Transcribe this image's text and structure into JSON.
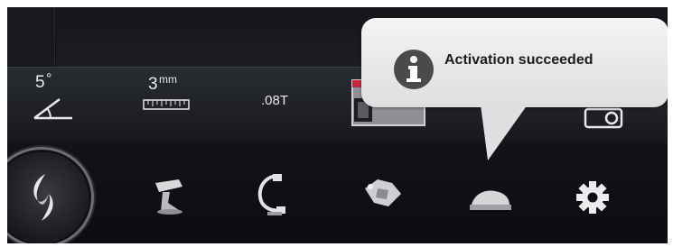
{
  "toolbar": {
    "angle": {
      "value": "5",
      "unit": "°",
      "icon": "angle-icon"
    },
    "thickness": {
      "value": "3",
      "unit": "mm",
      "icon": "ruler-icon"
    },
    "field": {
      "value": ".08T",
      "icon": "field-strength-icon"
    }
  },
  "notification": {
    "message": "Activation succeeded",
    "icon": "info-icon"
  },
  "nav": {
    "items": [
      {
        "id": "home",
        "icon": "logo-home-icon"
      },
      {
        "id": "table",
        "icon": "patient-table-icon"
      },
      {
        "id": "c-arm",
        "icon": "c-arm-icon"
      },
      {
        "id": "collimator",
        "icon": "collimator-icon"
      },
      {
        "id": "coil",
        "icon": "head-coil-icon"
      },
      {
        "id": "settings",
        "icon": "gear-icon"
      }
    ]
  },
  "colors": {
    "accent": "#2fb3e5",
    "background": "#0e0e10",
    "tooltip": "#ececec"
  }
}
